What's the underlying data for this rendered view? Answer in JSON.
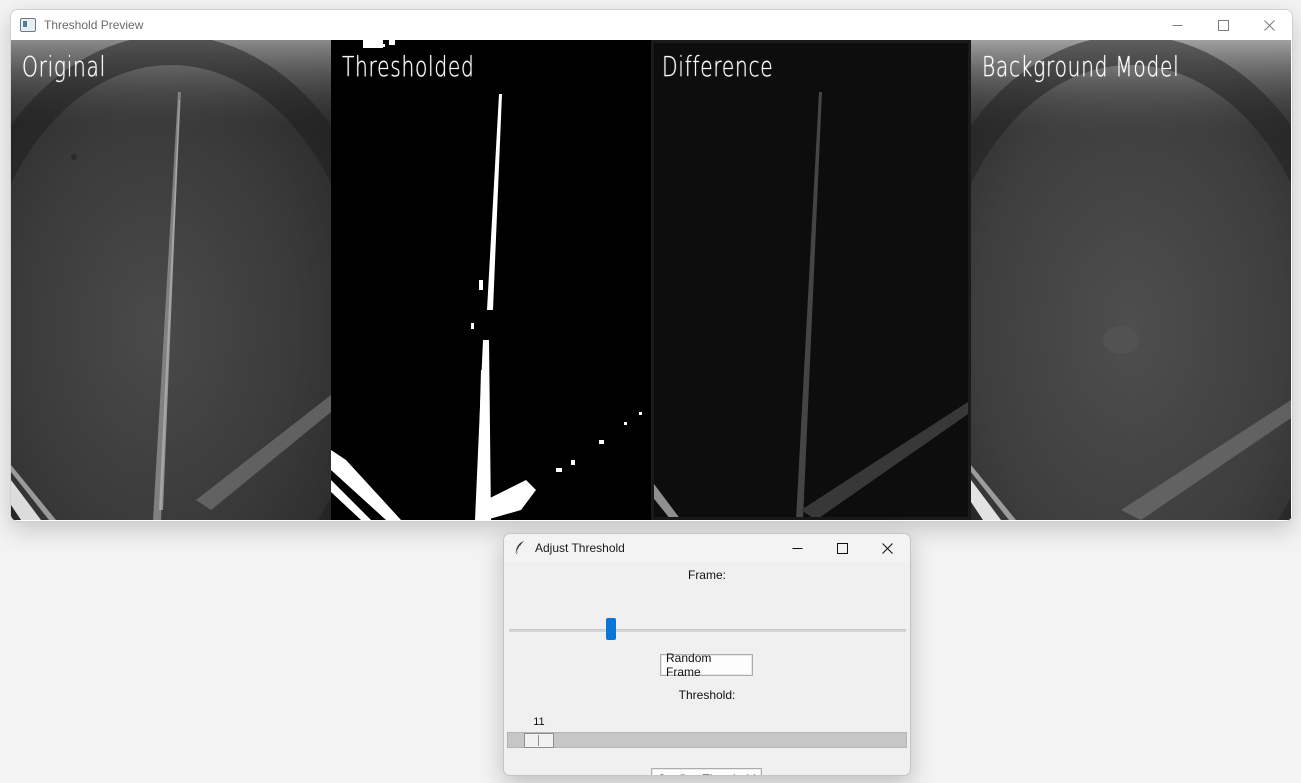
{
  "main_window": {
    "title": "Threshold Preview",
    "icon": "app-window-icon",
    "panels": [
      {
        "label": "Original"
      },
      {
        "label": "Thresholded"
      },
      {
        "label": "Difference"
      },
      {
        "label": "Background Model"
      }
    ]
  },
  "dialog": {
    "title": "Adjust Threshold",
    "icon": "feather-icon",
    "frame_label": "Frame:",
    "frame_slider_fraction": 0.25,
    "random_frame_label": "Random Frame",
    "threshold_label": "Threshold:",
    "threshold_value": "11",
    "threshold_fraction": 0.044,
    "confirm_label": "Confirm Threshold"
  },
  "colors": {
    "accent": "#0a75d6"
  }
}
